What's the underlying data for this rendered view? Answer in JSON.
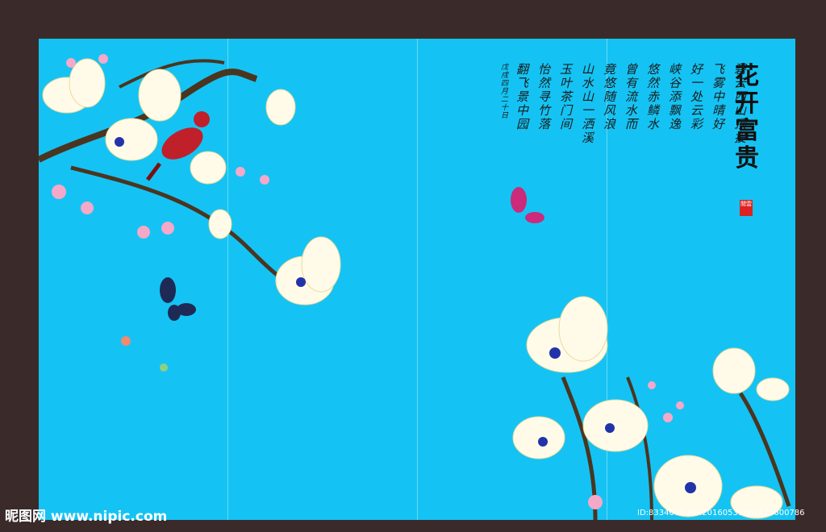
{
  "title": "花开富贵",
  "seal_text": "閒雲",
  "poem": {
    "columns": [
      "碧云西山顶投",
      "飞雾中晴好",
      "好一处云彩",
      "峡谷添飘逸",
      "悠然赤鳞水",
      "曾有流水而",
      "竟悠随风浪",
      "山水山一洒溪",
      "玉叶茶门间",
      "怡然寻竹落",
      "翻飞景中园"
    ],
    "signature": "戊戌四月二十日"
  },
  "watermark": {
    "brand": "昵图网",
    "site": "www.nipic.com",
    "id": "ID:8334070 NO:20160531001428600786"
  },
  "colors": {
    "background": "#14c3f3",
    "frame": "#3a2b2a",
    "flower": "#fffbe8",
    "seal": "#dd2222"
  }
}
